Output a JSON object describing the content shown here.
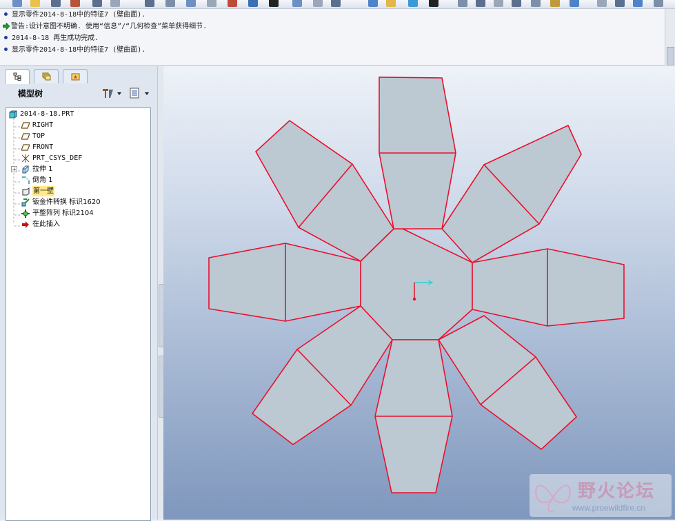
{
  "messages": [
    {
      "type": "info",
      "text": "显示零件2014-8-18中的特征7 (壁曲面)."
    },
    {
      "type": "warning",
      "text": "警告:设计意图不明确. 使用“信息”/“几何检查”菜单获得细节."
    },
    {
      "type": "info",
      "text": "2014-8-18  再生成功完成."
    },
    {
      "type": "info",
      "text": "显示零件2014-8-18中的特征7 (壁曲面)."
    }
  ],
  "panel": {
    "title": "模型树",
    "tabs": [
      "model-tree-tab",
      "layers-tab",
      "favorites-tab"
    ]
  },
  "tree": {
    "root": "2014-8-18.PRT",
    "items": [
      {
        "label": "RIGHT",
        "icon": "datum-plane-icon"
      },
      {
        "label": "TOP",
        "icon": "datum-plane-icon"
      },
      {
        "label": "FRONT",
        "icon": "datum-plane-icon"
      },
      {
        "label": "PRT_CSYS_DEF",
        "icon": "csys-icon"
      },
      {
        "label": "拉伸 1",
        "icon": "extrude-icon"
      },
      {
        "label": "倒角 1",
        "icon": "chamfer-icon"
      },
      {
        "label": "第一壁",
        "icon": "first-wall-icon"
      },
      {
        "label": "钣金件转换  标识1620",
        "icon": "sheetmetal-convert-icon"
      },
      {
        "label": "平整阵列  标识2104",
        "icon": "flat-pattern-icon"
      },
      {
        "label": "在此插入",
        "icon": "insert-here-icon"
      }
    ]
  },
  "watermark": {
    "title": "野火论坛",
    "url": "www.proewildfire.cn"
  },
  "colors": {
    "edge": "#e8112d",
    "part": "#bcc8d2",
    "info_bullet": "#1b3fa8",
    "warning_arrow": "#1e9a2a",
    "selected": "#ffe98a"
  }
}
